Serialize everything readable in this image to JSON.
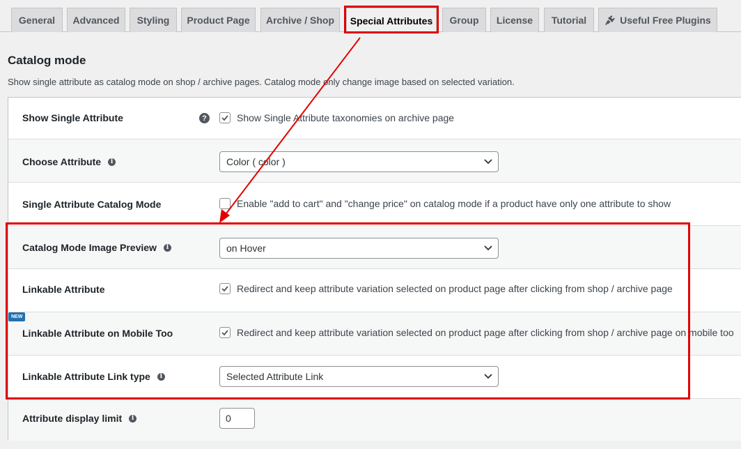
{
  "tabs": [
    {
      "label": "General",
      "active": false
    },
    {
      "label": "Advanced",
      "active": false
    },
    {
      "label": "Styling",
      "active": false
    },
    {
      "label": "Product Page",
      "active": false
    },
    {
      "label": "Archive / Shop",
      "active": false
    },
    {
      "label": "Special Attributes",
      "active": true
    },
    {
      "label": "Group",
      "active": false
    },
    {
      "label": "License",
      "active": false
    },
    {
      "label": "Tutorial",
      "active": false
    },
    {
      "label": "Useful Free Plugins",
      "active": false,
      "icon": "plug-icon"
    }
  ],
  "section": {
    "title": "Catalog mode",
    "description": "Show single attribute as catalog mode on shop / archive pages. Catalog mode only change image based on selected variation."
  },
  "settings": {
    "show_single_attribute": {
      "label": "Show Single Attribute",
      "checkbox_label": "Show Single Attribute taxonomies on archive page",
      "checked": true,
      "help_icon": "question-icon"
    },
    "choose_attribute": {
      "label": "Choose Attribute",
      "value": "Color ( color )",
      "icon": "info-icon"
    },
    "single_attribute_catalog_mode": {
      "label": "Single Attribute Catalog Mode",
      "checkbox_label": "Enable \"add to cart\" and \"change price\" on catalog mode if a product have only one attribute to show",
      "checked": false
    },
    "catalog_mode_image_preview": {
      "label": "Catalog Mode Image Preview",
      "value": "on Hover",
      "icon": "info-icon"
    },
    "linkable_attribute": {
      "label": "Linkable Attribute",
      "checkbox_label": "Redirect and keep attribute variation selected on product page after clicking from shop / archive page",
      "checked": true
    },
    "linkable_attribute_mobile": {
      "label": "Linkable Attribute on Mobile Too",
      "badge": "NEW",
      "checkbox_label": "Redirect and keep attribute variation selected on product page after clicking from shop / archive page on mobile too",
      "checked": true
    },
    "linkable_attribute_link_type": {
      "label": "Linkable Attribute Link type",
      "value": "Selected Attribute Link",
      "icon": "info-icon"
    },
    "attribute_display_limit": {
      "label": "Attribute display limit",
      "value": "0",
      "icon": "info-icon"
    }
  },
  "colors": {
    "annotation_red": "#e00000",
    "badge_blue": "#2271b1",
    "check_blue": "#2271b1"
  }
}
